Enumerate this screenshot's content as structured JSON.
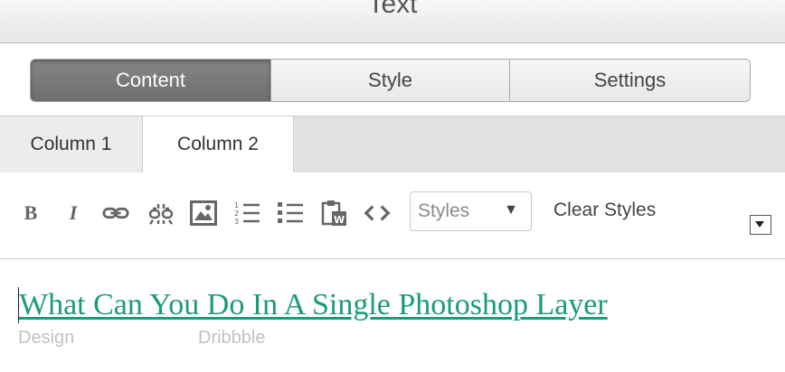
{
  "window": {
    "title": "Text"
  },
  "segments": [
    {
      "label": "Content",
      "active": true
    },
    {
      "label": "Style",
      "active": false
    },
    {
      "label": "Settings",
      "active": false
    }
  ],
  "tabs": [
    {
      "label": "Column 1",
      "active": false
    },
    {
      "label": "Column 2",
      "active": true
    }
  ],
  "toolbar": {
    "bold_label": "B",
    "italic_label": "I",
    "buttons": [
      "bold-icon",
      "italic-icon",
      "link-icon",
      "unlink-icon",
      "image-icon",
      "ordered-list-icon",
      "unordered-list-icon",
      "paste-from-word-icon",
      "source-code-icon"
    ],
    "styles_select": {
      "value": "Styles",
      "arrow": "▼"
    },
    "clear_styles_label": "Clear Styles"
  },
  "editor": {
    "headline": "What Can You Do In A Single Photoshop Layer",
    "meta_left": "Design",
    "meta_right": "Dribbble",
    "link_color": "#1a9b79"
  },
  "colors": {
    "active_segment": "#7a7a7a",
    "tabs_background": "#e1e1e1"
  }
}
